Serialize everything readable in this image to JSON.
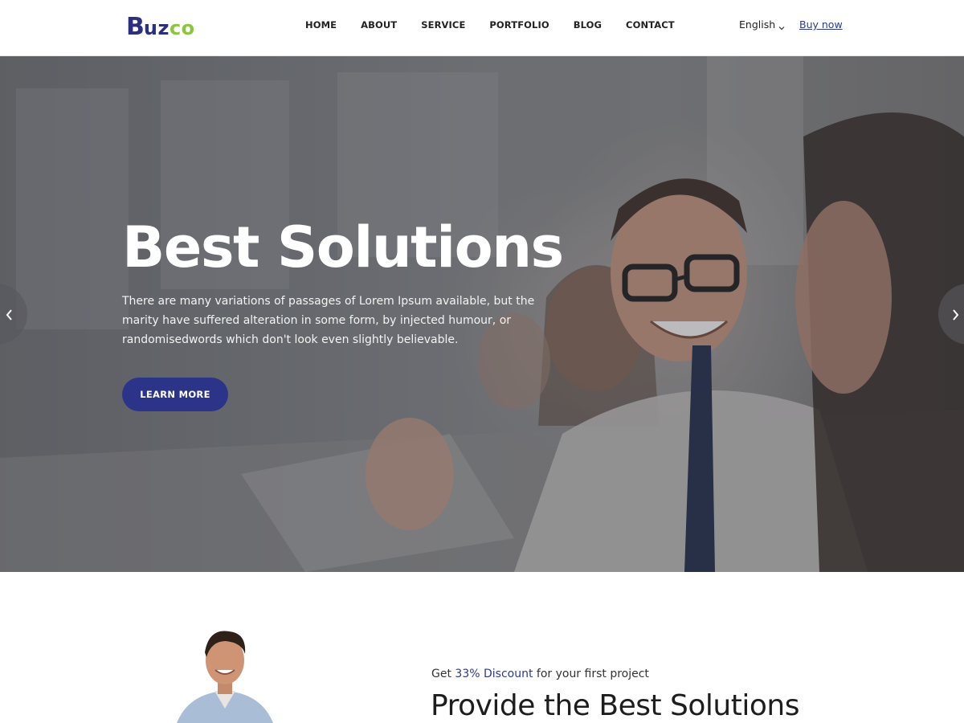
{
  "header": {
    "logo": {
      "first": "B",
      "middle": "uz",
      "last": "co"
    },
    "nav": [
      "HOME",
      "ABOUT",
      "SERVICE",
      "PORTFOLIO",
      "BLOG",
      "CONTACT"
    ],
    "language": "English",
    "buy_label": "Buy now"
  },
  "hero": {
    "title": "Best Solutions",
    "text": "There are many variations of passages of Lorem Ipsum available, but the marity have suffered alteration in some form, by injected humour, or randomisedwords which don't look even slightly believable.",
    "button_label": "LEARN MORE"
  },
  "intro": {
    "discount_prefix": "Get ",
    "discount_highlight": "33% Discount",
    "discount_suffix": " for your first project",
    "heading": "Provide the Best Solutions"
  },
  "colors": {
    "brand_navy": "#2b2f7f",
    "brand_green": "#8cc63f",
    "button": "#2b3489"
  },
  "icons": [
    "chevron-down-icon",
    "chevron-left-icon",
    "chevron-right-icon"
  ]
}
